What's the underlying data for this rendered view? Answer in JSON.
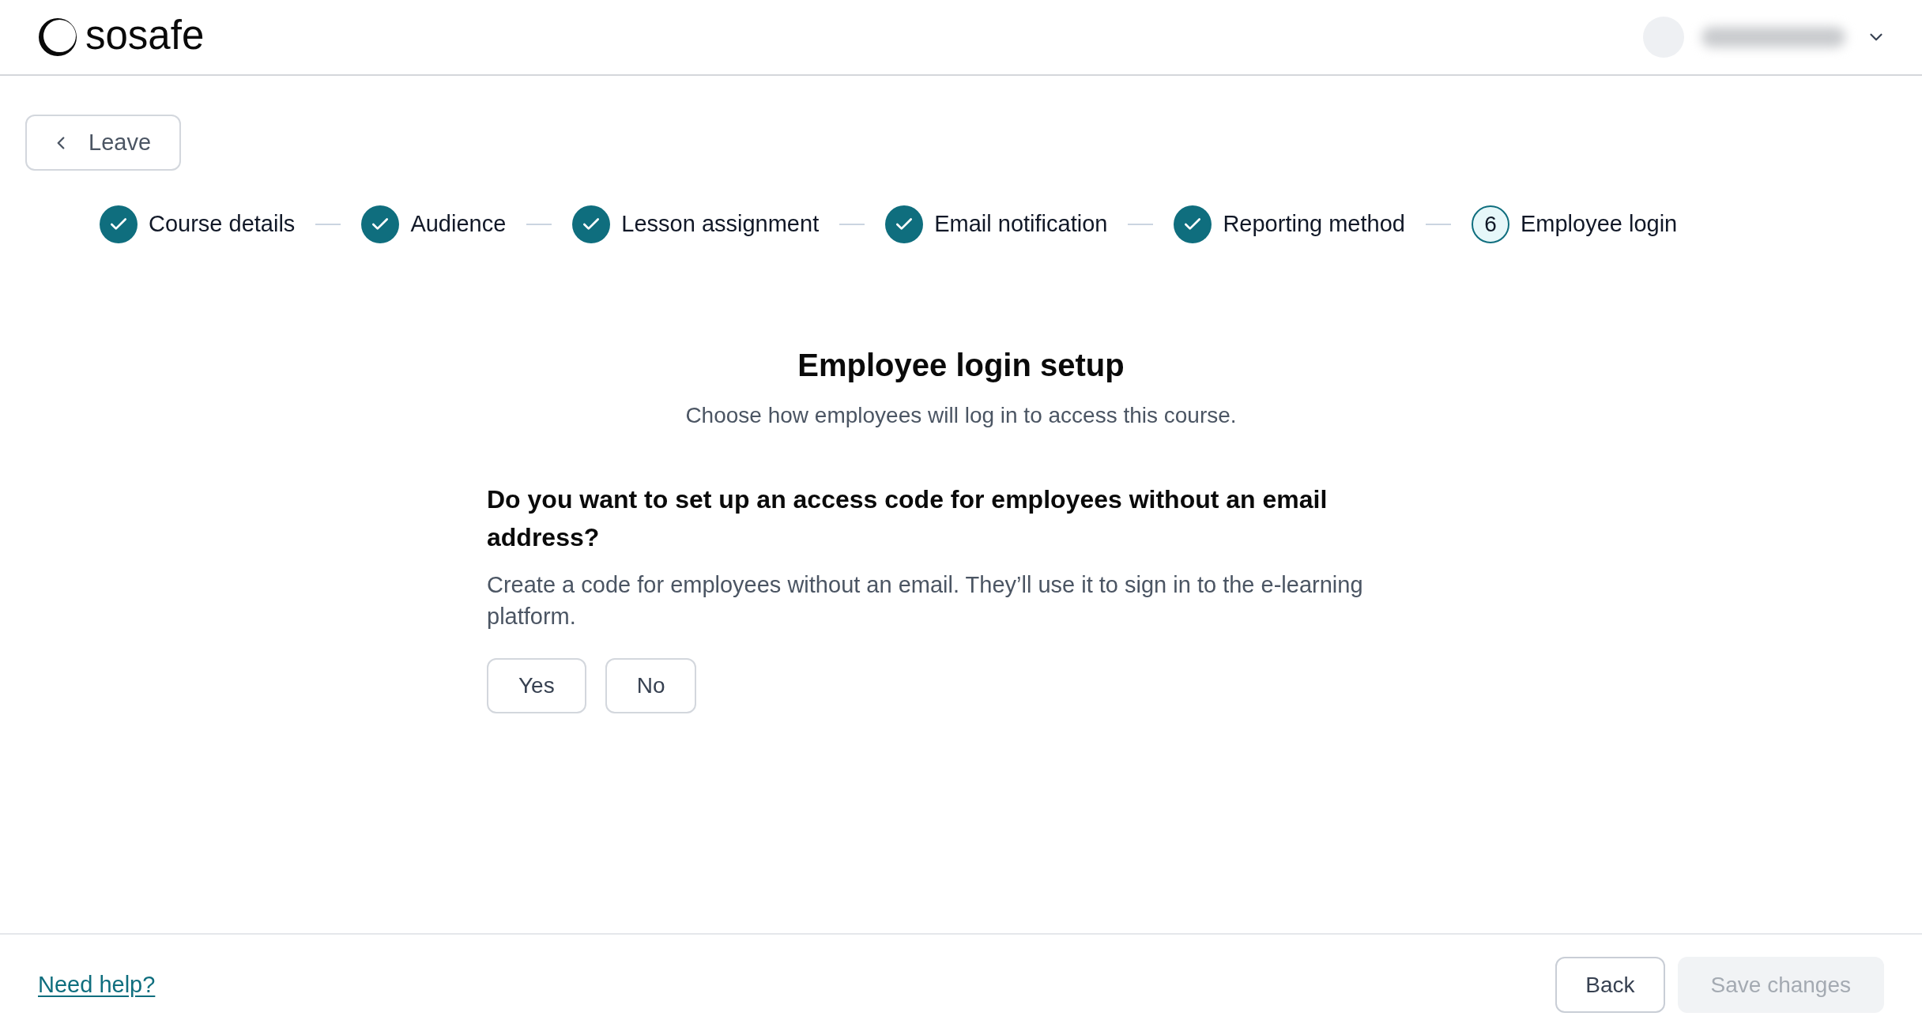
{
  "header": {
    "logo_text": "sosafe"
  },
  "leave_button": {
    "label": "Leave"
  },
  "steps": [
    {
      "label": "Course details",
      "completed": true,
      "selected": false
    },
    {
      "label": "Audience",
      "completed": true,
      "selected": false
    },
    {
      "label": "Lesson assignment",
      "completed": true,
      "selected": false
    },
    {
      "label": "Email notification",
      "completed": true,
      "selected": false
    },
    {
      "label": "Reporting method",
      "completed": true,
      "selected": false
    },
    {
      "label": "Employee login",
      "completed": false,
      "selected": true,
      "number": "6"
    }
  ],
  "intro": {
    "title": "Employee login setup",
    "subtitle": "Choose how employees will log in to access this course."
  },
  "question": {
    "text": "Do you want to set up an access code for employees without an email address?",
    "description": "Create a code for employees without an email. They’ll use it to sign in to the e-learning platform.",
    "options": [
      {
        "label": "Yes",
        "selected": false
      },
      {
        "label": "No",
        "selected": false
      }
    ]
  },
  "footer": {
    "help_link": "Need help?",
    "buttons": [
      {
        "label": "Back",
        "disabled": false
      },
      {
        "label": "Save changes",
        "disabled": true
      }
    ]
  }
}
